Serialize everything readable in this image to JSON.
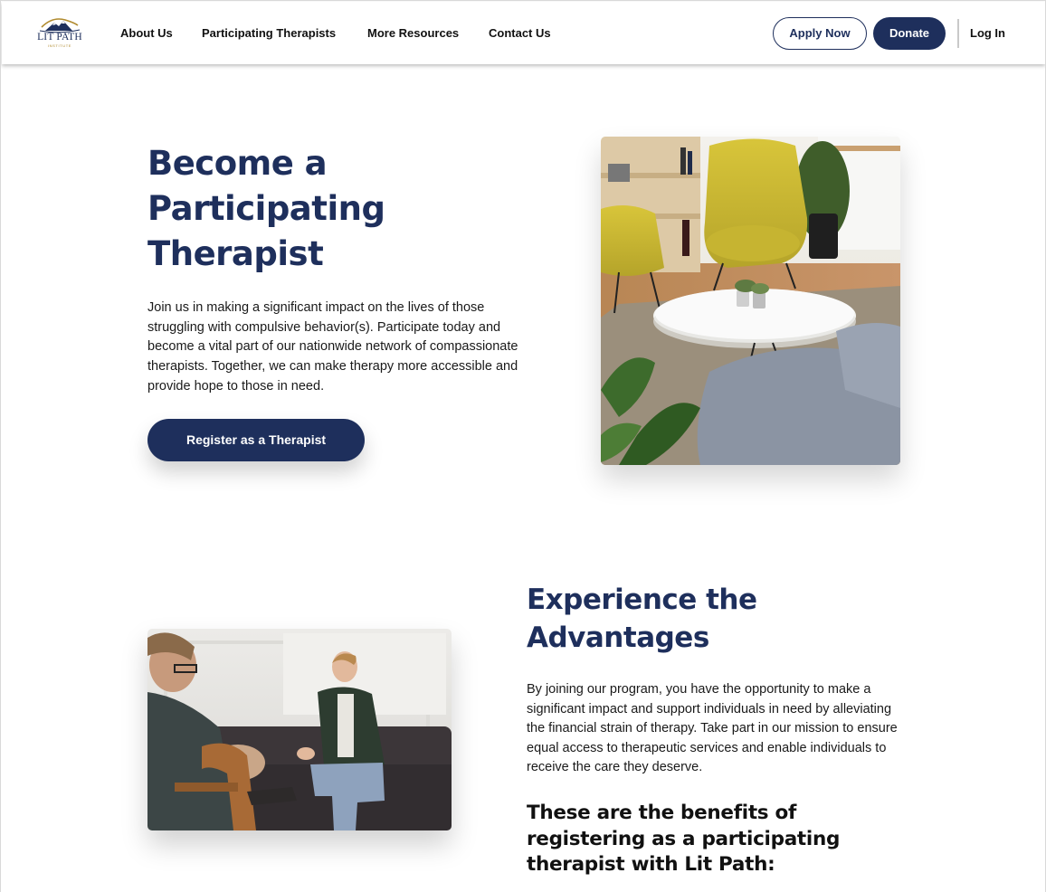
{
  "header": {
    "logo_text": "LIT PATH",
    "logo_tagline": "INSTITUTE",
    "nav": [
      "About Us",
      "Participating Therapists",
      "More Resources",
      "Contact Us"
    ],
    "apply_label": "Apply Now",
    "donate_label": "Donate",
    "login_label": "Log In"
  },
  "hero": {
    "title": "Become a Participating Therapist",
    "text": "Join us in making a significant impact on the lives of those struggling with compulsive behavior(s). Participate today and become a vital part of our nationwide network of compassionate therapists. Together, we can make therapy more accessible and provide hope to those in need.",
    "button_label": "Register as a Therapist"
  },
  "advantages": {
    "title": "Experience the Advantages",
    "text": "By joining our program, you have the opportunity to make a significant impact and support individuals in need by alleviating the financial strain of therapy. Take part in our mission to ensure equal access to therapeutic services and enable individuals to receive the care they deserve.",
    "benefits_title": "These are the benefits of registering as a participating therapist with Lit Path:"
  },
  "colors": {
    "brand_navy": "#1e2f5c",
    "logo_gold": "#b08a2e"
  }
}
